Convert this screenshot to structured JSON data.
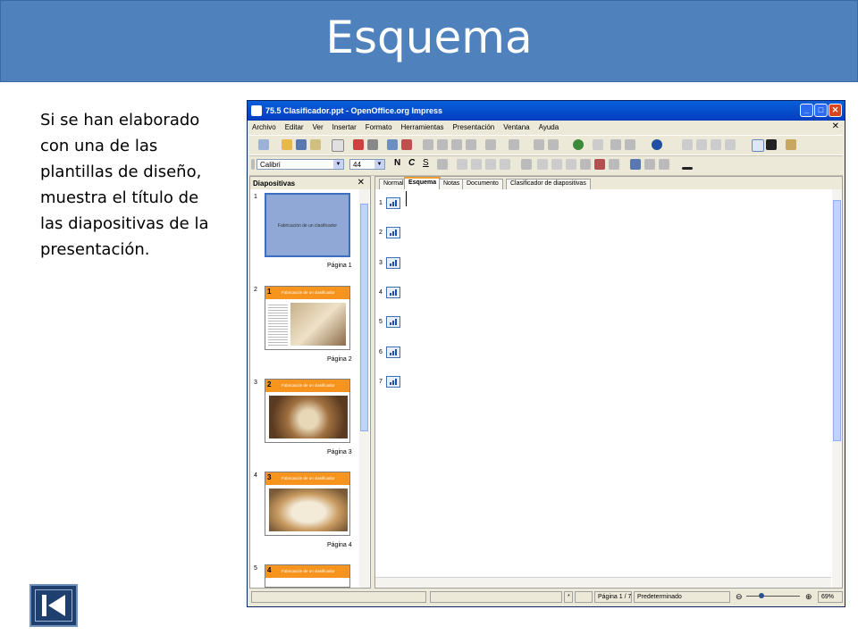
{
  "slide": {
    "title": "Esquema",
    "description": "Si se han elaborado con una de las plantillas de diseño, muestra el título de las diapositivas de la presentación."
  },
  "window": {
    "title": "75.5 Clasificador.ppt - OpenOffice.org Impress",
    "menu": [
      "Archivo",
      "Editar",
      "Ver",
      "Insertar",
      "Formato",
      "Herramientas",
      "Presentación",
      "Ventana",
      "Ayuda"
    ],
    "close_glyph": "✕"
  },
  "format_bar": {
    "font": "Calibri",
    "size": "44",
    "bold": "N",
    "italic": "C",
    "underline": "S"
  },
  "slides_panel": {
    "title": "Diapositivas",
    "close": "✕",
    "slides": [
      {
        "num": "1",
        "caption": "Fabricación de un clasificador",
        "page": "Página 1"
      },
      {
        "num": "2",
        "badge": "1",
        "header": "Fabricación de un clasificador",
        "page": "Página 2"
      },
      {
        "num": "3",
        "badge": "2",
        "header": "Fabricación de un clasificador",
        "page": "Página 3"
      },
      {
        "num": "4",
        "badge": "3",
        "header": "Fabricación de un clasificador",
        "page": "Página 4"
      },
      {
        "num": "5",
        "badge": "4",
        "header": "Fabricación de un clasificador"
      }
    ]
  },
  "tabs": [
    "Normal",
    "Esquema",
    "Notas",
    "Documento",
    "Clasificador de diapositivas"
  ],
  "outline_rows": [
    "1",
    "2",
    "3",
    "4",
    "5",
    "6",
    "7"
  ],
  "status": {
    "star": "*",
    "page": "Página 1 / 7",
    "layout": "Predeterminado",
    "zoom": "69%"
  },
  "colors": {
    "banner": "#4f81bd",
    "orange": "#f7941d",
    "titlebar": "#0a5fd8"
  }
}
